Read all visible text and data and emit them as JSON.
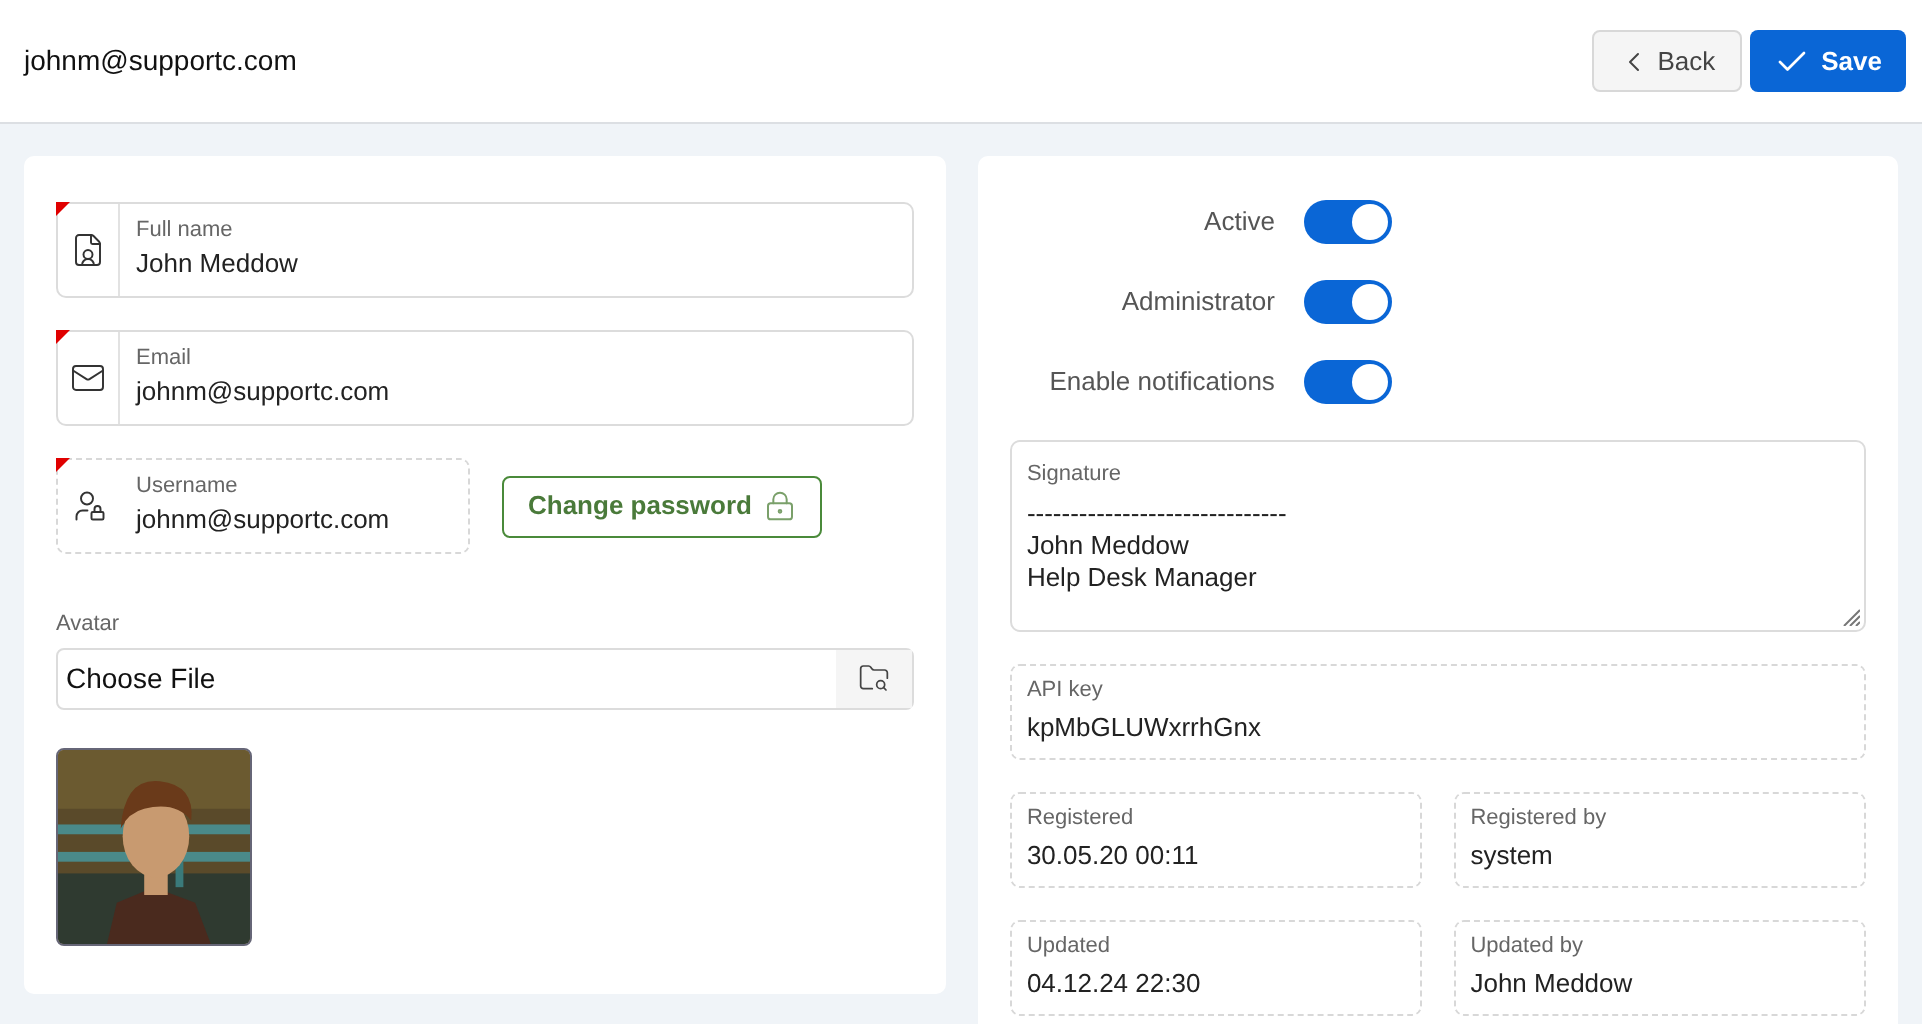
{
  "header": {
    "title": "johnm@supportc.com",
    "back_label": "Back",
    "save_label": "Save"
  },
  "identity_fields": [
    {
      "label": "Full name",
      "value": "John Meddow",
      "kind": "name",
      "required": true,
      "readonly": false
    },
    {
      "label": "Email",
      "value": "johnm@supportc.com",
      "kind": "email",
      "required": true,
      "readonly": false
    },
    {
      "label": "Username",
      "value": "johnm@supportc.com",
      "kind": "username",
      "required": true,
      "readonly": true
    }
  ],
  "change_password": "Change password",
  "avatar": {
    "label": "Avatar",
    "button": "Choose File"
  },
  "toggles": [
    {
      "label": "Active",
      "on": true
    },
    {
      "label": "Administrator",
      "on": true
    },
    {
      "label": "Enable notifications",
      "on": true
    }
  ],
  "signature": {
    "label": "Signature",
    "value": "------------------------------\nJohn Meddow\nHelp Desk Manager"
  },
  "api_key": {
    "label": "API key",
    "value": "kpMbGLUWxrrhGnx"
  },
  "info_fields": [
    {
      "label": "Registered",
      "value": "30.05.20 00:11"
    },
    {
      "label": "Registered by",
      "value": "system"
    },
    {
      "label": "Updated",
      "value": "04.12.24 22:30"
    },
    {
      "label": "Updated by",
      "value": "John Meddow"
    }
  ]
}
